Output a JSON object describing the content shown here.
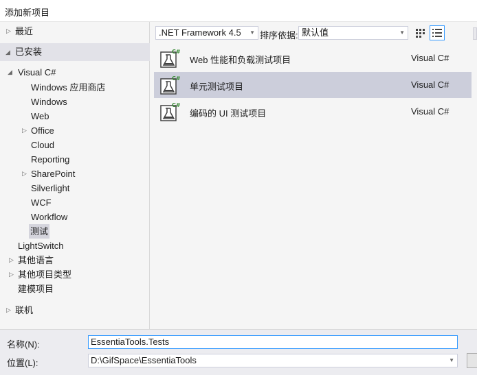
{
  "window": {
    "title": "添加新项目"
  },
  "tree": {
    "recent": "最近",
    "installed": "已安装",
    "visual_csharp": "Visual C#",
    "children": [
      "Windows 应用商店",
      "Windows",
      "Web",
      "Office",
      "Cloud",
      "Reporting",
      "SharePoint",
      "Silverlight",
      "WCF",
      "Workflow",
      "测试"
    ],
    "lightswitch": "LightSwitch",
    "other_languages": "其他语言",
    "other_project_types": "其他项目类型",
    "modeling_projects": "建模项目",
    "online": "联机"
  },
  "toolbar": {
    "framework": ".NET Framework 4.5",
    "sort_label": "排序依据:",
    "sort_value": "默认值"
  },
  "templates": [
    {
      "name": "Web 性能和负载测试项目",
      "lang": "Visual C#",
      "badge": "C#"
    },
    {
      "name": "单元测试项目",
      "lang": "Visual C#",
      "badge": "C#"
    },
    {
      "name": "编码的 UI 测试项目",
      "lang": "Visual C#",
      "badge": "C#"
    }
  ],
  "form": {
    "name_label": "名称(N):",
    "name_value": "EssentiaTools.Tests",
    "location_label": "位置(L):",
    "location_value": "D:\\GifSpace\\EssentiaTools"
  },
  "colors": {
    "accent": "#3399ff",
    "selection": "#cccedb",
    "csharp_green": "#388a34"
  }
}
